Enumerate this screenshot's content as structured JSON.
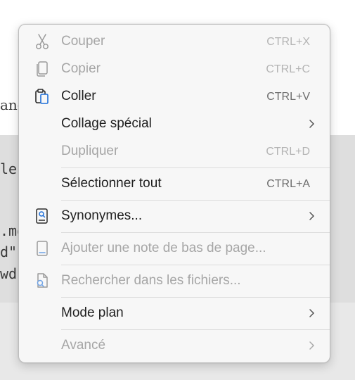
{
  "background": {
    "fragments": [
      "anc",
      "le",
      ".mo",
      "d\"",
      "wd|"
    ]
  },
  "menu": {
    "items": [
      {
        "label": "Couper",
        "shortcut": "CTRL+X",
        "icon": "scissors-icon",
        "enabled": false
      },
      {
        "label": "Copier",
        "shortcut": "CTRL+C",
        "icon": "copy-icon",
        "enabled": false
      },
      {
        "label": "Coller",
        "shortcut": "CTRL+V",
        "icon": "paste-icon",
        "enabled": true
      },
      {
        "label": "Collage spécial",
        "submenu": true,
        "enabled": true
      },
      {
        "label": "Dupliquer",
        "shortcut": "CTRL+D",
        "enabled": false
      },
      {
        "label": "Sélectionner tout",
        "shortcut": "CTRL+A",
        "enabled": true
      },
      {
        "label": "Synonymes...",
        "submenu": true,
        "icon": "thesaurus-icon",
        "enabled": true
      },
      {
        "label": "Ajouter une note de bas de page...",
        "icon": "footnote-icon",
        "enabled": false
      },
      {
        "label": "Rechercher dans les fichiers...",
        "icon": "search-files-icon",
        "enabled": false
      },
      {
        "label": "Mode plan",
        "submenu": true,
        "enabled": true
      },
      {
        "label": "Avancé",
        "submenu": true,
        "enabled": false
      }
    ]
  },
  "colors": {
    "accent": "#1e6fd9",
    "text": "#1f1f1f",
    "disabled_text": "#a6a6a6",
    "menu_bg": "#f7f7f7"
  }
}
